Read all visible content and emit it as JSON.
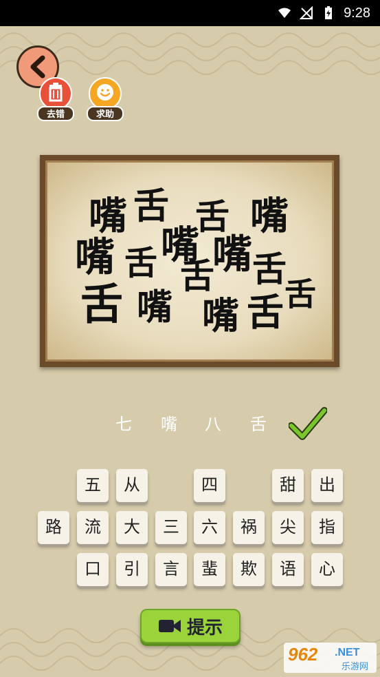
{
  "status_bar": {
    "time": "9:28"
  },
  "toolbar": {
    "remove_wrong_label": "去错",
    "help_label": "求助"
  },
  "puzzle": {
    "chars": [
      "嘴",
      "舌",
      "舌",
      "嘴",
      "嘴",
      "舌",
      "嘴",
      "嘴",
      "舌",
      "舌",
      "舌",
      "嘴",
      "舌",
      "嘴",
      "舌",
      "舌"
    ]
  },
  "answer": {
    "chars": [
      "七",
      "嘴",
      "八",
      "舌"
    ],
    "correct": true
  },
  "tiles": {
    "row1": [
      "五",
      "从",
      "",
      "四",
      "",
      "甜",
      "出"
    ],
    "row2": [
      "路",
      "流",
      "大",
      "三",
      "六",
      "祸",
      "尖",
      "指"
    ],
    "row3": [
      "口",
      "引",
      "言",
      "蜚",
      "欺",
      "语",
      "心"
    ]
  },
  "hint_button": {
    "label": "提示"
  },
  "watermark": {
    "brand": "962",
    "suffix": ".NET",
    "cn": "乐游网"
  },
  "colors": {
    "background": "#d6cbab",
    "hint_green": "#9ad43a",
    "back_button": "#f09a7a",
    "remove_red": "#e8503a",
    "help_orange": "#f5a623"
  }
}
